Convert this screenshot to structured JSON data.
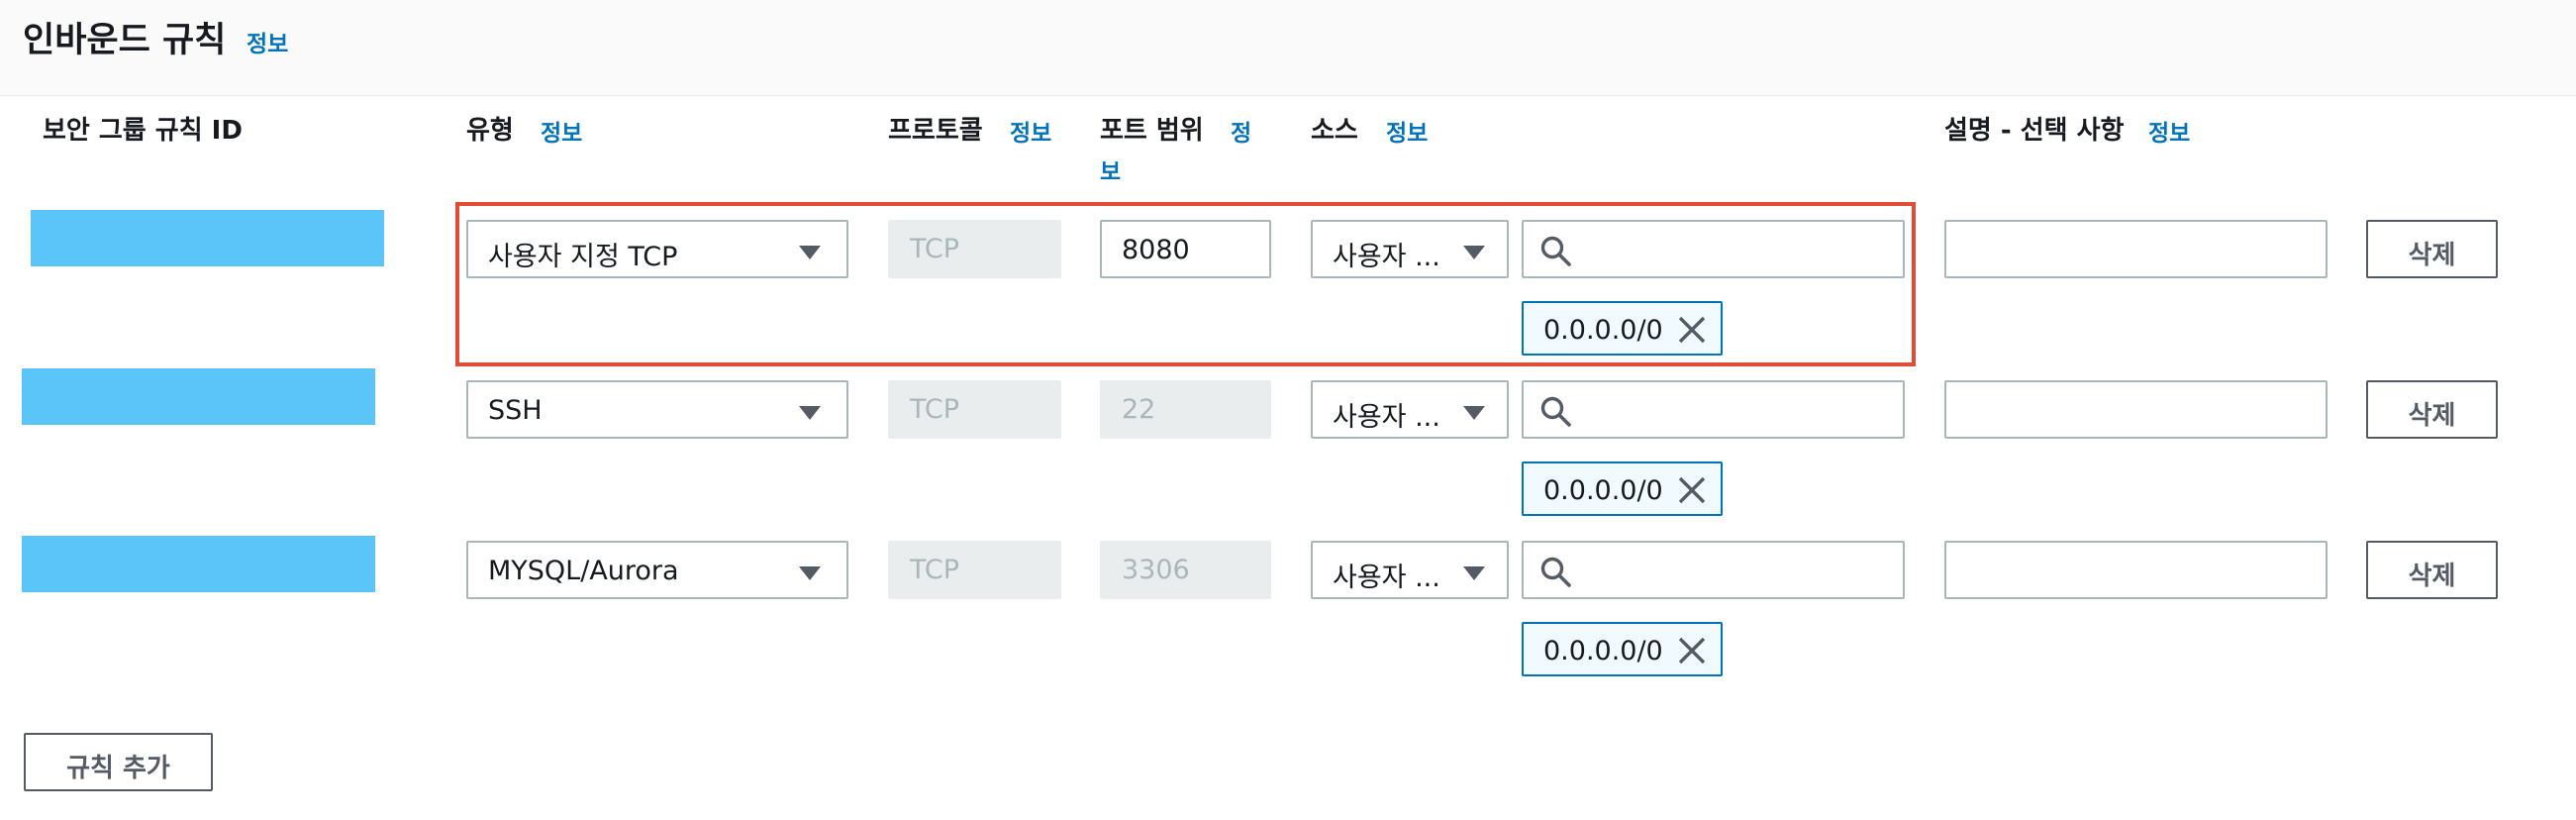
{
  "section": {
    "title": "인바운드 규칙",
    "info": "정보"
  },
  "columns": {
    "rule_id": "보안 그룹 규칙 ID",
    "type": "유형",
    "protocol": "프로토콜",
    "port_range": "포트 범위",
    "source": "소스",
    "description": "설명 - 선택 사항",
    "info": "정보",
    "port_info_line1": "정",
    "port_info_line2": "보"
  },
  "rules": [
    {
      "type": "사용자 지정 TCP",
      "protocol": "TCP",
      "port": "8080",
      "source_type": "사용자 ...",
      "search_value": "",
      "cidr": "0.0.0.0/0",
      "description": "",
      "delete_label": "삭제",
      "port_editable": true
    },
    {
      "type": "SSH",
      "protocol": "TCP",
      "port": "22",
      "source_type": "사용자 ...",
      "search_value": "",
      "cidr": "0.0.0.0/0",
      "description": "",
      "delete_label": "삭제",
      "port_editable": false
    },
    {
      "type": "MYSQL/Aurora",
      "protocol": "TCP",
      "port": "3306",
      "source_type": "사용자 ...",
      "search_value": "",
      "cidr": "0.0.0.0/0",
      "description": "",
      "delete_label": "삭제",
      "port_editable": false
    }
  ],
  "add_rule_label": "규칙 추가",
  "colors": {
    "info_link": "#0073bb",
    "redaction": "#5bc4f9",
    "highlight": "#e24b35",
    "token_bg": "#f1faff",
    "disabled_bg": "#eaeded"
  },
  "icons": {
    "search": "search-icon",
    "remove": "close-icon",
    "dropdown": "caret-down-icon"
  }
}
